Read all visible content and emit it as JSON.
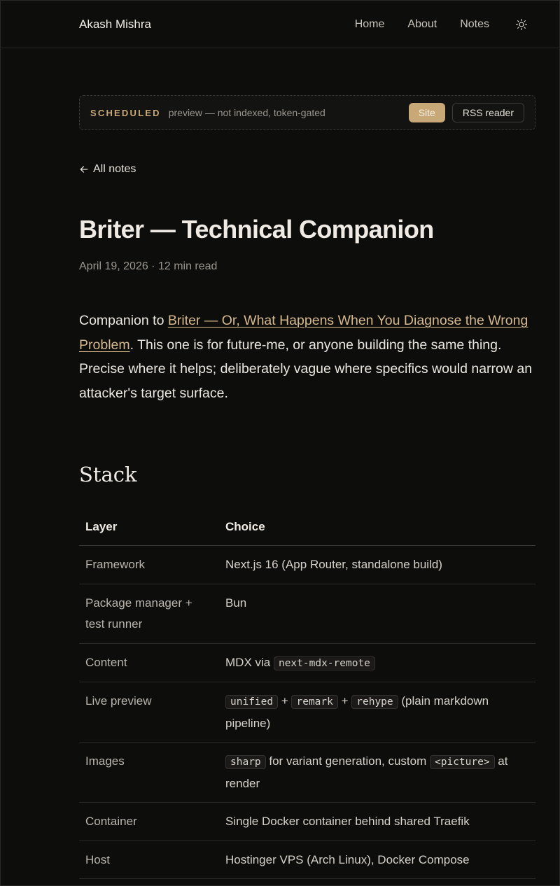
{
  "header": {
    "brand": "Akash Mishra",
    "nav": [
      {
        "label": "Home"
      },
      {
        "label": "About"
      },
      {
        "label": "Notes"
      }
    ]
  },
  "banner": {
    "tag": "SCHEDULED",
    "note": "preview — not indexed, token-gated",
    "site_label": "Site",
    "rss_label": "RSS reader"
  },
  "back_link": "All notes",
  "article": {
    "title": "Briter — Technical Companion",
    "meta": "April 19, 2026 · 12 min read",
    "intro_prefix": "Companion to ",
    "intro_link": "Briter — Or, What Happens When You Diagnose the Wrong Problem",
    "intro_rest": ". This one is for future-me, or anyone building the same thing. Precise where it helps; deliberately vague where specifics would narrow an attacker's target surface."
  },
  "stack": {
    "heading": "Stack",
    "columns": [
      "Layer",
      "Choice"
    ],
    "rows": [
      {
        "layer": "Framework",
        "choice": [
          {
            "t": "Next.js 16 (App Router, standalone build)"
          }
        ]
      },
      {
        "layer": "Package manager + test runner",
        "choice": [
          {
            "t": "Bun"
          }
        ]
      },
      {
        "layer": "Content",
        "choice": [
          {
            "t": "MDX via "
          },
          {
            "code": "next-mdx-remote"
          }
        ]
      },
      {
        "layer": "Live preview",
        "choice": [
          {
            "code": "unified"
          },
          {
            "t": " + "
          },
          {
            "code": "remark"
          },
          {
            "t": " + "
          },
          {
            "code": "rehype"
          },
          {
            "t": " (plain markdown pipeline)"
          }
        ]
      },
      {
        "layer": "Images",
        "choice": [
          {
            "code": "sharp"
          },
          {
            "t": " for variant generation, custom "
          },
          {
            "code": "<picture>"
          },
          {
            "t": " at render"
          }
        ]
      },
      {
        "layer": "Container",
        "choice": [
          {
            "t": "Single Docker container behind shared Traefik"
          }
        ]
      },
      {
        "layer": "Host",
        "choice": [
          {
            "t": "Hostinger VPS (Arch Linux), Docker Compose"
          }
        ]
      }
    ]
  },
  "colors": {
    "background": "#0d0d0c",
    "accent": "#c9a878",
    "link": "#d6b98d"
  },
  "icons": {
    "theme_toggle": "sun-icon",
    "back": "arrow-left-icon"
  }
}
